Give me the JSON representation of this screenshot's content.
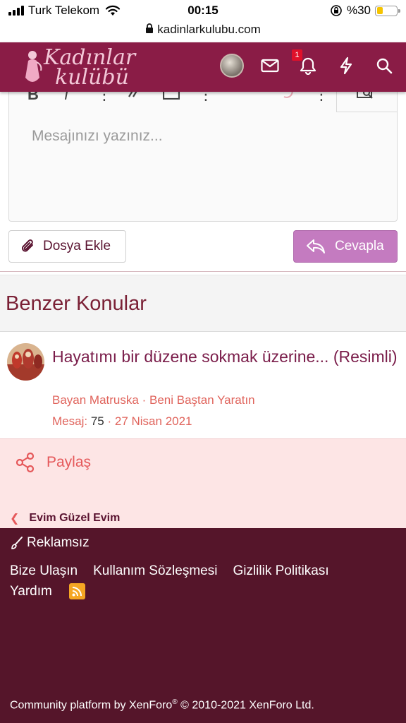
{
  "status_bar": {
    "carrier": "Turk Telekom",
    "time": "00:15",
    "battery_text": "%30",
    "battery_level": 0.3
  },
  "url_bar": {
    "url": "kadinlarkulubu.com"
  },
  "header": {
    "logo_line1": "Kadınlar",
    "logo_line2": "kulübü",
    "notification_count": "1",
    "brand_color": "#8a1c46"
  },
  "editor": {
    "placeholder": "Mesajınızı yazınız...",
    "toolbar": [
      "B",
      "I",
      "⋮",
      "link-icon",
      "image-icon",
      "⋮",
      "undo-icon",
      "⋮",
      "preview-icon"
    ]
  },
  "actions": {
    "attach_label": "Dosya Ekle",
    "reply_label": "Cevapla"
  },
  "similar": {
    "heading": "Benzer Konular",
    "thread": {
      "title": "Hayatımı bir düzene sokmak üzerine... (Resimli)",
      "author": "Bayan Matruska",
      "separator": "·",
      "forum": "Beni Baştan Yaratın",
      "messages_label": "Mesaj:",
      "messages_count": "75",
      "date": "27 Nisan 2021"
    }
  },
  "share": {
    "label": "Paylaş"
  },
  "breadcrumb": {
    "label": "Evim Güzel Evim"
  },
  "footer": {
    "reklamsiz": "Reklamsız",
    "links": [
      "Bize Ulaşın",
      "Kullanım Sözleşmesi",
      "Gizlilik Politikası"
    ],
    "help": "Yardım",
    "copyright_pre": "Community platform by XenForo",
    "copyright_reg": "®",
    "copyright_post": " © 2010-2021 XenForo Ltd.",
    "bg_color": "#55152a"
  }
}
